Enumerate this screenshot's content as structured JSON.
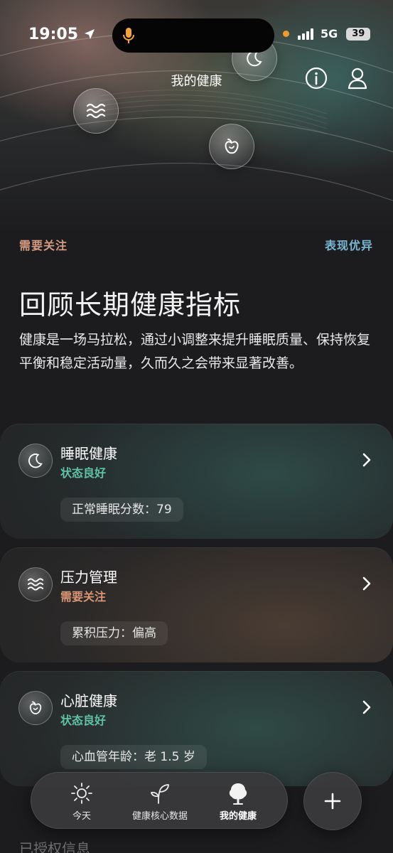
{
  "status_bar": {
    "time": "19:05",
    "network": "5G",
    "battery": "39"
  },
  "nav": {
    "title": "我的健康"
  },
  "legend": {
    "attention": "需要关注",
    "excellent": "表现优异"
  },
  "intro": {
    "headline": "回顾长期健康指标",
    "description": "健康是一场马拉松，通过小调整来提升睡眠质量、保持恢复平衡和稳定活动量，久而久之会带来显著改善。"
  },
  "cards": [
    {
      "title": "睡眠健康",
      "status": "状态良好",
      "metric": "正常睡眠分数：79",
      "icon": "moon-icon"
    },
    {
      "title": "压力管理",
      "status": "需要关注",
      "metric": "累积压力：偏高",
      "icon": "waves-icon"
    },
    {
      "title": "心脏健康",
      "status": "状态良好",
      "metric": "心血管年龄：老 1.5 岁",
      "icon": "heart-apple-icon"
    }
  ],
  "tabbar": {
    "items": [
      {
        "label": "今天",
        "icon": "sun-icon"
      },
      {
        "label": "健康核心数据",
        "icon": "sprout-icon"
      },
      {
        "label": "我的健康",
        "icon": "tree-icon",
        "active": true
      }
    ]
  },
  "footer_peek": "已授权信息",
  "colors": {
    "good": "#5fc2a4",
    "warn": "#d99573",
    "link": "#79b7d4"
  }
}
